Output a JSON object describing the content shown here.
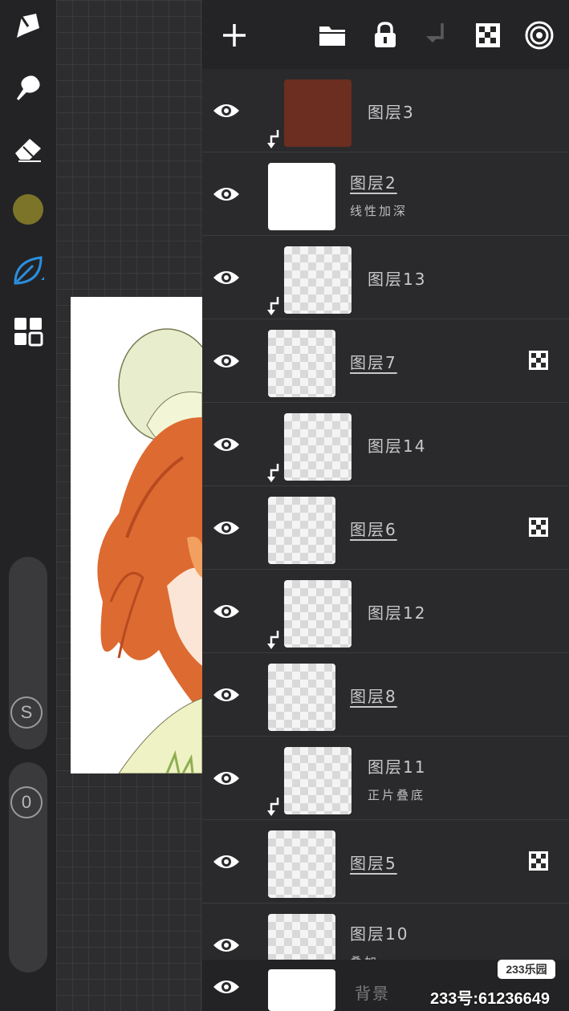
{
  "panel": {
    "header": {
      "icons": [
        "add-icon",
        "folder-icon",
        "lock-icon",
        "merge-down-icon",
        "alpha-checker-icon",
        "layer-target-icon"
      ],
      "accent_color": "#ffffff"
    },
    "layers": [
      {
        "name": "图层3",
        "mode": "",
        "clipped": true,
        "alpha_locked": false,
        "underline": false,
        "thumb": "solid-brown",
        "thumb_color": "#6b2e20"
      },
      {
        "name": "图层2",
        "mode": "线性加深",
        "clipped": false,
        "alpha_locked": false,
        "underline": true,
        "thumb": "lineart"
      },
      {
        "name": "图层13",
        "mode": "",
        "clipped": true,
        "alpha_locked": false,
        "underline": false,
        "thumb": "transparent"
      },
      {
        "name": "图层7",
        "mode": "",
        "clipped": false,
        "alpha_locked": true,
        "underline": true,
        "thumb": "transparent"
      },
      {
        "name": "图层14",
        "mode": "",
        "clipped": true,
        "alpha_locked": false,
        "underline": false,
        "thumb": "transparent"
      },
      {
        "name": "图层6",
        "mode": "",
        "clipped": false,
        "alpha_locked": true,
        "underline": true,
        "thumb": "transparent"
      },
      {
        "name": "图层12",
        "mode": "",
        "clipped": true,
        "alpha_locked": false,
        "underline": false,
        "thumb": "transparent"
      },
      {
        "name": "图层8",
        "mode": "",
        "clipped": false,
        "alpha_locked": false,
        "underline": true,
        "thumb": "transparent"
      },
      {
        "name": "图层11",
        "mode": "正片叠底",
        "clipped": true,
        "alpha_locked": false,
        "underline": false,
        "thumb": "transparent"
      },
      {
        "name": "图层5",
        "mode": "",
        "clipped": false,
        "alpha_locked": true,
        "underline": true,
        "thumb": "transparent"
      },
      {
        "name": "图层10",
        "mode": "叠加",
        "clipped": false,
        "alpha_locked": false,
        "underline": false,
        "thumb": "transparent"
      }
    ],
    "background_layer": {
      "name": "背景"
    }
  },
  "toolbar": {
    "tools": [
      "brush-icon",
      "smudge-icon",
      "eraser-icon",
      "color-swatch",
      "leaf-brush-icon",
      "layers-grid-icon"
    ],
    "color_swatch": "#7c7428",
    "active_tool_color": "#2a8fe0",
    "size_label": "S",
    "opacity_label": "0"
  },
  "watermark": {
    "badge": "233乐园",
    "id_text": "233号:61236649"
  }
}
